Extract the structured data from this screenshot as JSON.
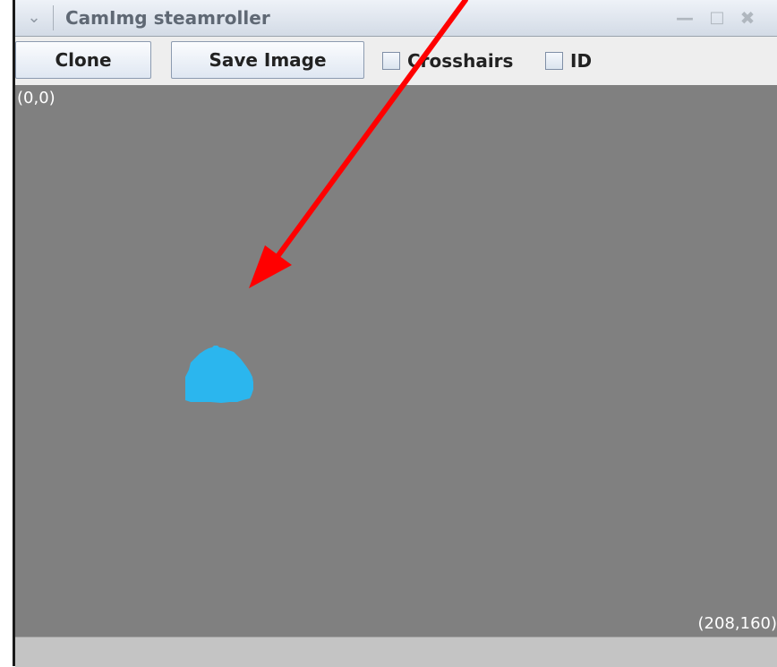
{
  "window": {
    "title": "CamImg steamroller",
    "menu_icon": "chevron-down-icon",
    "minimize_icon": "minimize-icon",
    "maximize_icon": "maximize-icon",
    "close_icon": "close-icon"
  },
  "toolbar": {
    "clone_label": "Clone",
    "save_image_label": "Save Image",
    "crosshairs_label": "Crosshairs",
    "crosshairs_checked": false,
    "id_label": "ID",
    "id_checked": false
  },
  "canvas": {
    "top_left_coord": "(0,0)",
    "bottom_right_coord": "(208,160)",
    "background_color": "#808080",
    "blob_color": "#2bb6ee"
  },
  "annotation": {
    "arrow_color": "#ff0000"
  }
}
